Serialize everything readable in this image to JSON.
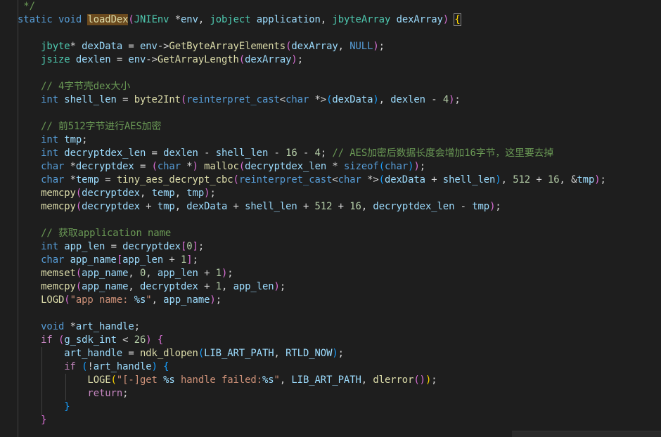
{
  "editor": {
    "lines": [
      [
        [
          "tok-cmt",
          " */"
        ]
      ],
      [
        [
          "tok-kw",
          "static"
        ],
        [
          "tok-plain",
          " "
        ],
        [
          "tok-kw",
          "void"
        ],
        [
          "tok-plain",
          " "
        ],
        [
          "tok-fnhl",
          "loadDex"
        ],
        [
          "tok-bracket",
          "("
        ],
        [
          "tok-type",
          "JNIEnv"
        ],
        [
          "tok-plain",
          " *"
        ],
        [
          "tok-var",
          "env"
        ],
        [
          "tok-plain",
          ", "
        ],
        [
          "tok-type",
          "jobject"
        ],
        [
          "tok-plain",
          " "
        ],
        [
          "tok-var",
          "application"
        ],
        [
          "tok-plain",
          ", "
        ],
        [
          "tok-type",
          "jbyteArray"
        ],
        [
          "tok-plain",
          " "
        ],
        [
          "tok-var",
          "dexArray"
        ],
        [
          "tok-bracket",
          ")"
        ],
        [
          "tok-plain",
          " "
        ],
        [
          "tok-bracehl",
          "{"
        ]
      ],
      [],
      [
        [
          "tok-plain",
          "    "
        ],
        [
          "tok-type",
          "jbyte"
        ],
        [
          "tok-plain",
          "* "
        ],
        [
          "tok-var",
          "dexData"
        ],
        [
          "tok-plain",
          " = "
        ],
        [
          "tok-var",
          "env"
        ],
        [
          "tok-plain",
          "->"
        ],
        [
          "tok-fn",
          "GetByteArrayElements"
        ],
        [
          "tok-bracket",
          "("
        ],
        [
          "tok-var",
          "dexArray"
        ],
        [
          "tok-plain",
          ", "
        ],
        [
          "tok-kw",
          "NULL"
        ],
        [
          "tok-bracket",
          ")"
        ],
        [
          "tok-plain",
          ";"
        ]
      ],
      [
        [
          "tok-plain",
          "    "
        ],
        [
          "tok-type",
          "jsize"
        ],
        [
          "tok-plain",
          " "
        ],
        [
          "tok-var",
          "dexlen"
        ],
        [
          "tok-plain",
          " = "
        ],
        [
          "tok-var",
          "env"
        ],
        [
          "tok-plain",
          "->"
        ],
        [
          "tok-fn",
          "GetArrayLength"
        ],
        [
          "tok-bracket",
          "("
        ],
        [
          "tok-var",
          "dexArray"
        ],
        [
          "tok-bracket",
          ")"
        ],
        [
          "tok-plain",
          ";"
        ]
      ],
      [],
      [
        [
          "tok-plain",
          "    "
        ],
        [
          "tok-cmt",
          "// 4字节壳dex大小"
        ]
      ],
      [
        [
          "tok-plain",
          "    "
        ],
        [
          "tok-kw",
          "int"
        ],
        [
          "tok-plain",
          " "
        ],
        [
          "tok-var",
          "shell_len"
        ],
        [
          "tok-plain",
          " = "
        ],
        [
          "tok-fn",
          "byte2Int"
        ],
        [
          "tok-bracket",
          "("
        ],
        [
          "tok-kw",
          "reinterpret_cast"
        ],
        [
          "tok-plain",
          "<"
        ],
        [
          "tok-kw",
          "char"
        ],
        [
          "tok-plain",
          " *>"
        ],
        [
          "tok-bracket2",
          "("
        ],
        [
          "tok-var",
          "dexData"
        ],
        [
          "tok-bracket2",
          ")"
        ],
        [
          "tok-plain",
          ", "
        ],
        [
          "tok-var",
          "dexlen"
        ],
        [
          "tok-plain",
          " - "
        ],
        [
          "tok-num",
          "4"
        ],
        [
          "tok-bracket",
          ")"
        ],
        [
          "tok-plain",
          ";"
        ]
      ],
      [],
      [
        [
          "tok-plain",
          "    "
        ],
        [
          "tok-cmt",
          "// 前512字节进行AES加密"
        ]
      ],
      [
        [
          "tok-plain",
          "    "
        ],
        [
          "tok-kw",
          "int"
        ],
        [
          "tok-plain",
          " "
        ],
        [
          "tok-var",
          "tmp"
        ],
        [
          "tok-plain",
          ";"
        ]
      ],
      [
        [
          "tok-plain",
          "    "
        ],
        [
          "tok-kw",
          "int"
        ],
        [
          "tok-plain",
          " "
        ],
        [
          "tok-var",
          "decryptdex_len"
        ],
        [
          "tok-plain",
          " = "
        ],
        [
          "tok-var",
          "dexlen"
        ],
        [
          "tok-plain",
          " - "
        ],
        [
          "tok-var",
          "shell_len"
        ],
        [
          "tok-plain",
          " - "
        ],
        [
          "tok-num",
          "16"
        ],
        [
          "tok-plain",
          " - "
        ],
        [
          "tok-num",
          "4"
        ],
        [
          "tok-plain",
          "; "
        ],
        [
          "tok-cmt",
          "// AES加密后数据长度会增加16字节，这里要去掉"
        ]
      ],
      [
        [
          "tok-plain",
          "    "
        ],
        [
          "tok-kw",
          "char"
        ],
        [
          "tok-plain",
          " *"
        ],
        [
          "tok-var",
          "decryptdex"
        ],
        [
          "tok-plain",
          " = "
        ],
        [
          "tok-bracket",
          "("
        ],
        [
          "tok-kw",
          "char"
        ],
        [
          "tok-plain",
          " *"
        ],
        [
          "tok-bracket",
          ")"
        ],
        [
          "tok-plain",
          " "
        ],
        [
          "tok-fn",
          "malloc"
        ],
        [
          "tok-bracket",
          "("
        ],
        [
          "tok-var",
          "decryptdex_len"
        ],
        [
          "tok-plain",
          " * "
        ],
        [
          "tok-kw",
          "sizeof"
        ],
        [
          "tok-bracket2",
          "("
        ],
        [
          "tok-kw",
          "char"
        ],
        [
          "tok-bracket2",
          ")"
        ],
        [
          "tok-bracket",
          ")"
        ],
        [
          "tok-plain",
          ";"
        ]
      ],
      [
        [
          "tok-plain",
          "    "
        ],
        [
          "tok-kw",
          "char"
        ],
        [
          "tok-plain",
          " *"
        ],
        [
          "tok-var",
          "temp"
        ],
        [
          "tok-plain",
          " = "
        ],
        [
          "tok-fn",
          "tiny_aes_decrypt_cbc"
        ],
        [
          "tok-bracket",
          "("
        ],
        [
          "tok-kw",
          "reinterpret_cast"
        ],
        [
          "tok-plain",
          "<"
        ],
        [
          "tok-kw",
          "char"
        ],
        [
          "tok-plain",
          " *>"
        ],
        [
          "tok-bracket2",
          "("
        ],
        [
          "tok-var",
          "dexData"
        ],
        [
          "tok-plain",
          " + "
        ],
        [
          "tok-var",
          "shell_len"
        ],
        [
          "tok-bracket2",
          ")"
        ],
        [
          "tok-plain",
          ", "
        ],
        [
          "tok-num",
          "512"
        ],
        [
          "tok-plain",
          " + "
        ],
        [
          "tok-num",
          "16"
        ],
        [
          "tok-plain",
          ", &"
        ],
        [
          "tok-var",
          "tmp"
        ],
        [
          "tok-bracket",
          ")"
        ],
        [
          "tok-plain",
          ";"
        ]
      ],
      [
        [
          "tok-plain",
          "    "
        ],
        [
          "tok-fn",
          "memcpy"
        ],
        [
          "tok-bracket",
          "("
        ],
        [
          "tok-var",
          "decryptdex"
        ],
        [
          "tok-plain",
          ", "
        ],
        [
          "tok-var",
          "temp"
        ],
        [
          "tok-plain",
          ", "
        ],
        [
          "tok-var",
          "tmp"
        ],
        [
          "tok-bracket",
          ")"
        ],
        [
          "tok-plain",
          ";"
        ]
      ],
      [
        [
          "tok-plain",
          "    "
        ],
        [
          "tok-fn",
          "memcpy"
        ],
        [
          "tok-bracket",
          "("
        ],
        [
          "tok-var",
          "decryptdex"
        ],
        [
          "tok-plain",
          " + "
        ],
        [
          "tok-var",
          "tmp"
        ],
        [
          "tok-plain",
          ", "
        ],
        [
          "tok-var",
          "dexData"
        ],
        [
          "tok-plain",
          " + "
        ],
        [
          "tok-var",
          "shell_len"
        ],
        [
          "tok-plain",
          " + "
        ],
        [
          "tok-num",
          "512"
        ],
        [
          "tok-plain",
          " + "
        ],
        [
          "tok-num",
          "16"
        ],
        [
          "tok-plain",
          ", "
        ],
        [
          "tok-var",
          "decryptdex_len"
        ],
        [
          "tok-plain",
          " - "
        ],
        [
          "tok-var",
          "tmp"
        ],
        [
          "tok-bracket",
          ")"
        ],
        [
          "tok-plain",
          ";"
        ]
      ],
      [],
      [
        [
          "tok-plain",
          "    "
        ],
        [
          "tok-cmt",
          "// 获取application name"
        ]
      ],
      [
        [
          "tok-plain",
          "    "
        ],
        [
          "tok-kw",
          "int"
        ],
        [
          "tok-plain",
          " "
        ],
        [
          "tok-var",
          "app_len"
        ],
        [
          "tok-plain",
          " = "
        ],
        [
          "tok-var",
          "decryptdex"
        ],
        [
          "tok-bracket",
          "["
        ],
        [
          "tok-num",
          "0"
        ],
        [
          "tok-bracket",
          "]"
        ],
        [
          "tok-plain",
          ";"
        ]
      ],
      [
        [
          "tok-plain",
          "    "
        ],
        [
          "tok-kw",
          "char"
        ],
        [
          "tok-plain",
          " "
        ],
        [
          "tok-var",
          "app_name"
        ],
        [
          "tok-bracket",
          "["
        ],
        [
          "tok-var",
          "app_len"
        ],
        [
          "tok-plain",
          " + "
        ],
        [
          "tok-num",
          "1"
        ],
        [
          "tok-bracket",
          "]"
        ],
        [
          "tok-plain",
          ";"
        ]
      ],
      [
        [
          "tok-plain",
          "    "
        ],
        [
          "tok-fn",
          "memset"
        ],
        [
          "tok-bracket",
          "("
        ],
        [
          "tok-var",
          "app_name"
        ],
        [
          "tok-plain",
          ", "
        ],
        [
          "tok-num",
          "0"
        ],
        [
          "tok-plain",
          ", "
        ],
        [
          "tok-var",
          "app_len"
        ],
        [
          "tok-plain",
          " + "
        ],
        [
          "tok-num",
          "1"
        ],
        [
          "tok-bracket",
          ")"
        ],
        [
          "tok-plain",
          ";"
        ]
      ],
      [
        [
          "tok-plain",
          "    "
        ],
        [
          "tok-fn",
          "memcpy"
        ],
        [
          "tok-bracket",
          "("
        ],
        [
          "tok-var",
          "app_name"
        ],
        [
          "tok-plain",
          ", "
        ],
        [
          "tok-var",
          "decryptdex"
        ],
        [
          "tok-plain",
          " + "
        ],
        [
          "tok-num",
          "1"
        ],
        [
          "tok-plain",
          ", "
        ],
        [
          "tok-var",
          "app_len"
        ],
        [
          "tok-bracket",
          ")"
        ],
        [
          "tok-plain",
          ";"
        ]
      ],
      [
        [
          "tok-plain",
          "    "
        ],
        [
          "tok-macro",
          "LOGD"
        ],
        [
          "tok-bracket",
          "("
        ],
        [
          "tok-str",
          "\"app name: "
        ],
        [
          "tok-var",
          "%s"
        ],
        [
          "tok-str",
          "\""
        ],
        [
          "tok-plain",
          ", "
        ],
        [
          "tok-var",
          "app_name"
        ],
        [
          "tok-bracket",
          ")"
        ],
        [
          "tok-plain",
          ";"
        ]
      ],
      [],
      [
        [
          "tok-plain",
          "    "
        ],
        [
          "tok-kw",
          "void"
        ],
        [
          "tok-plain",
          " *"
        ],
        [
          "tok-var",
          "art_handle"
        ],
        [
          "tok-plain",
          ";"
        ]
      ],
      [
        [
          "tok-plain",
          "    "
        ],
        [
          "tok-ctrl",
          "if"
        ],
        [
          "tok-plain",
          " "
        ],
        [
          "tok-bracket",
          "("
        ],
        [
          "tok-var",
          "g_sdk_int"
        ],
        [
          "tok-plain",
          " < "
        ],
        [
          "tok-num",
          "26"
        ],
        [
          "tok-bracket",
          ")"
        ],
        [
          "tok-plain",
          " "
        ],
        [
          "tok-bracket",
          "{"
        ]
      ],
      [
        [
          "tok-plain",
          "        "
        ],
        [
          "tok-var",
          "art_handle"
        ],
        [
          "tok-plain",
          " = "
        ],
        [
          "tok-fn",
          "ndk_dlopen"
        ],
        [
          "tok-bracket2",
          "("
        ],
        [
          "tok-var",
          "LIB_ART_PATH"
        ],
        [
          "tok-plain",
          ", "
        ],
        [
          "tok-var",
          "RTLD_NOW"
        ],
        [
          "tok-bracket2",
          ")"
        ],
        [
          "tok-plain",
          ";"
        ]
      ],
      [
        [
          "tok-plain",
          "        "
        ],
        [
          "tok-ctrl",
          "if"
        ],
        [
          "tok-plain",
          " "
        ],
        [
          "tok-bracket2",
          "("
        ],
        [
          "tok-plain",
          "!"
        ],
        [
          "tok-var",
          "art_handle"
        ],
        [
          "tok-bracket2",
          ")"
        ],
        [
          "tok-plain",
          " "
        ],
        [
          "tok-bracket2",
          "{"
        ]
      ],
      [
        [
          "tok-plain",
          "            "
        ],
        [
          "tok-macro",
          "LOGE"
        ],
        [
          "tok-brace",
          "("
        ],
        [
          "tok-str",
          "\"[-]get "
        ],
        [
          "tok-var",
          "%s"
        ],
        [
          "tok-str",
          " handle failed:"
        ],
        [
          "tok-var",
          "%s"
        ],
        [
          "tok-str",
          "\""
        ],
        [
          "tok-plain",
          ", "
        ],
        [
          "tok-var",
          "LIB_ART_PATH"
        ],
        [
          "tok-plain",
          ", "
        ],
        [
          "tok-fn",
          "dlerror"
        ],
        [
          "tok-bracket",
          "()"
        ],
        [
          "tok-brace",
          ")"
        ],
        [
          "tok-plain",
          ";"
        ]
      ],
      [
        [
          "tok-plain",
          "            "
        ],
        [
          "tok-ctrl",
          "return"
        ],
        [
          "tok-plain",
          ";"
        ]
      ],
      [
        [
          "tok-plain",
          "        "
        ],
        [
          "tok-bracket2",
          "}"
        ]
      ],
      [
        [
          "tok-plain",
          "    "
        ],
        [
          "tok-bracket",
          "}"
        ]
      ]
    ]
  },
  "colors": {
    "background": "#1e1e1e",
    "keyword": "#569cd6",
    "type": "#4ec9b0",
    "function": "#dcdcaa",
    "variable": "#9cdcfe",
    "number": "#b5cea8",
    "string": "#ce9178",
    "comment": "#6a9955"
  }
}
